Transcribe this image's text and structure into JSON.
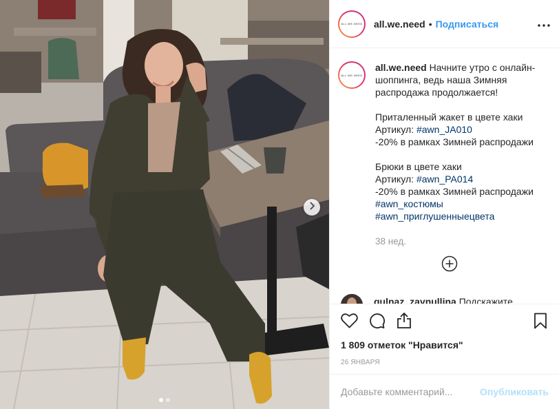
{
  "header": {
    "avatar_logo_text": "ALL.WE.NEED",
    "username": "all.we.need",
    "separator": "•",
    "follow_label": "Подписаться",
    "more_icon": "more-horizontal-icon"
  },
  "caption": {
    "username": "all.we.need",
    "line1": "Начните утро с онлайн-шоппинга, ведь наша Зимняя распродажа продолжается!",
    "item1_title": "Приталенный жакет в цвете хаки",
    "item1_sku_label": "Артикул: ",
    "item1_sku_tag": "#awn_JA010",
    "item1_discount": "-20% в рамках Зимней распродажи",
    "item2_title": "Брюки в цвете хаки",
    "item2_sku_label": "Артикул: ",
    "item2_sku_tag": "#awn_PA014",
    "item2_discount": "-20% в рамках Зимней распродажи",
    "tag1": "#awn_костюмы",
    "tag2": "#awn_приглушенныецвета",
    "time": "38 нед."
  },
  "load_more_icon": "plus-circle-icon",
  "comment": {
    "username": "gulnaz_zaynullina",
    "text": "Подскажите"
  },
  "actions": {
    "like_icon": "heart-icon",
    "comment_icon": "comment-icon",
    "share_icon": "share-icon",
    "save_icon": "bookmark-icon"
  },
  "likes_text": "1 809 отметок \"Нравится\"",
  "date_text": "26 января",
  "add_comment": {
    "placeholder": "Добавьте комментарий...",
    "publish_label": "Опубликовать"
  },
  "carousel": {
    "slide_count": 2,
    "active_index": 0,
    "next_icon": "chevron-right-icon"
  },
  "colors": {
    "link": "#003569",
    "follow": "#3897f0",
    "muted": "#999999",
    "publish_disabled": "#b2dffc"
  }
}
